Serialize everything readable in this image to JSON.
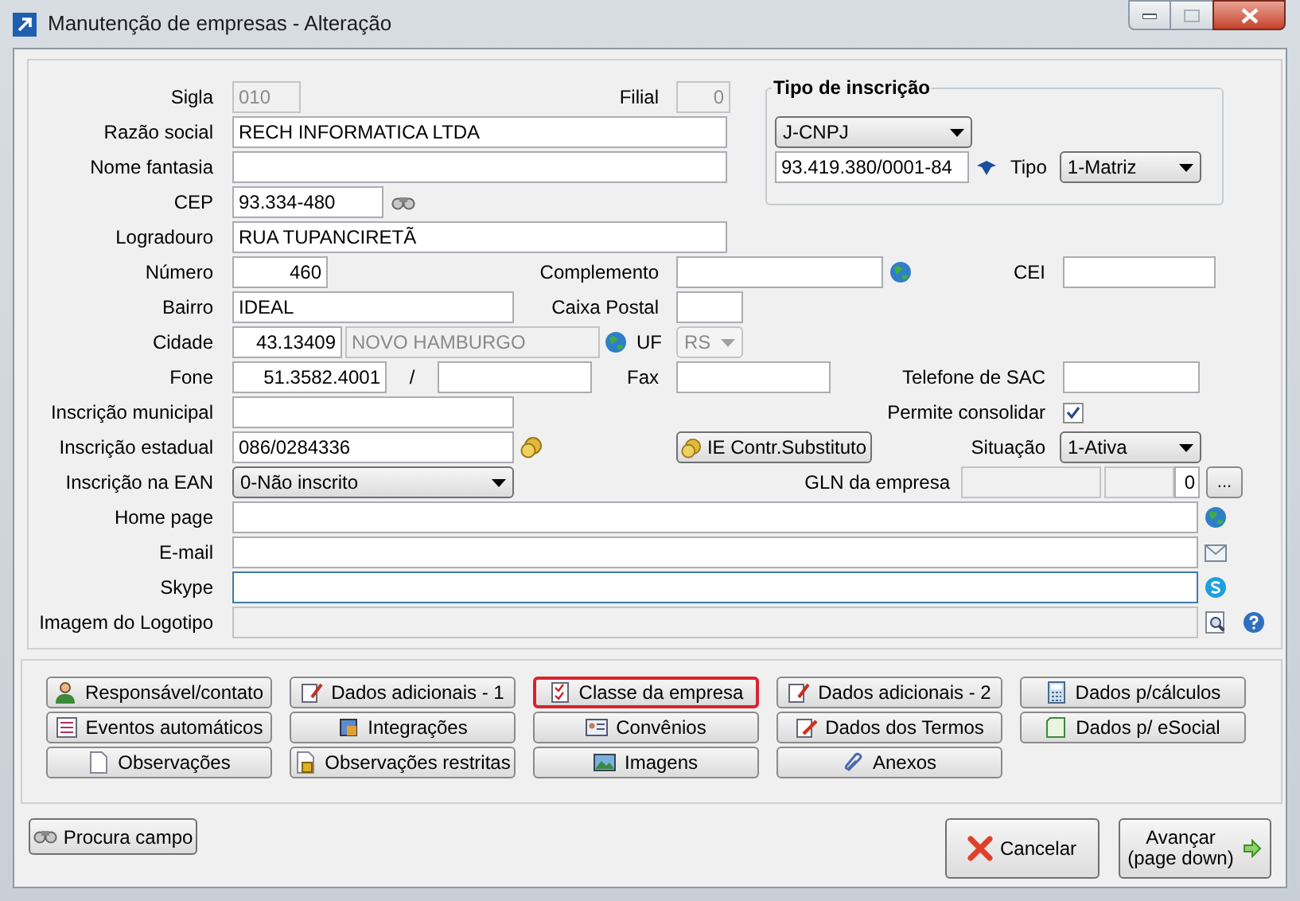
{
  "window": {
    "title": "Manutenção de empresas - Alteração"
  },
  "form": {
    "sigla": {
      "label": "Sigla",
      "value": "010",
      "disabled": true
    },
    "filial": {
      "label": "Filial",
      "value": "0",
      "disabled": true
    },
    "razao_social": {
      "label": "Razão social",
      "value": "RECH INFORMATICA LTDA",
      "disabled": false
    },
    "nome_fantasia": {
      "label": "Nome fantasia",
      "disabled": false
    },
    "cep": {
      "label": "CEP",
      "value": "93.334-480",
      "disabled": false
    },
    "logradouro": {
      "label": "Logradouro",
      "value": "RUA TUPANCIRETÃ",
      "disabled": false
    },
    "numero": {
      "label": "Número",
      "value": "460",
      "disabled": false
    },
    "complemento": {
      "label": "Complemento",
      "disabled": false
    },
    "cei": {
      "label": "CEI",
      "disabled": false
    },
    "bairro": {
      "label": "Bairro",
      "value": "IDEAL",
      "disabled": false
    },
    "caixa_postal": {
      "label": "Caixa Postal",
      "disabled": false
    },
    "cidade": {
      "label": "Cidade",
      "value": "43.13409",
      "disabled": false
    },
    "cidade_nome": {
      "value": "NOVO HAMBURGO",
      "disabled": true
    },
    "uf": {
      "label": "UF",
      "value": "RS",
      "disabled": true
    },
    "fone": {
      "label": "Fone",
      "value": "51.3582.4001",
      "disabled": false
    },
    "fone_separator": "/",
    "fone_2": {
      "disabled": false
    },
    "fax": {
      "label": "Fax",
      "disabled": false
    },
    "telefone_sac": {
      "label": "Telefone de SAC",
      "disabled": false
    },
    "inscricao_municipal": {
      "label": "Inscrição municipal",
      "disabled": false
    },
    "permite_consolidar": {
      "label": "Permite consolidar",
      "checked": true
    },
    "inscricao_estadual": {
      "label": "Inscrição estadual",
      "value": "086/0284336",
      "disabled": false
    },
    "ie_button": {
      "label": "IE Contr.Substituto"
    },
    "situacao": {
      "label": "Situação",
      "value": "1-Ativa",
      "disabled": false
    },
    "inscricao_ean": {
      "label": "Inscrição na EAN",
      "value": "0-Não inscrito",
      "disabled": false
    },
    "gln_label": "GLN da empresa",
    "gln_1": {
      "disabled": true
    },
    "gln_2": {
      "disabled": true
    },
    "gln_3": {
      "value": "0",
      "disabled": false
    },
    "gln_button": "...",
    "home_page": {
      "label": "Home page",
      "disabled": false
    },
    "email": {
      "label": "E-mail",
      "disabled": false
    },
    "skype": {
      "label": "Skype",
      "disabled": false,
      "focused": true
    },
    "imagem_logotipo": {
      "label": "Imagem do Logotipo",
      "disabled": true
    }
  },
  "tipo_inscricao": {
    "title": "Tipo de inscrição",
    "documento": {
      "value": "J-CNPJ",
      "disabled": false
    },
    "numero": {
      "value": "93.419.380/0001-84",
      "disabled": false
    },
    "tipo": {
      "label": "Tipo",
      "value": "1-Matriz",
      "disabled": false
    }
  },
  "buttons": [
    {
      "label": "Responsável/contato",
      "highlighted": false
    },
    {
      "label": "Dados adicionais - 1",
      "highlighted": false
    },
    {
      "label": "Classe da empresa",
      "highlighted": true
    },
    {
      "label": "Dados adicionais - 2",
      "highlighted": false
    },
    {
      "label": "Dados p/cálculos",
      "highlighted": false
    },
    {
      "label": "Eventos automáticos",
      "highlighted": false
    },
    {
      "label": "Integrações",
      "highlighted": false
    },
    {
      "label": "Convênios",
      "highlighted": false
    },
    {
      "label": "Dados dos Termos",
      "highlighted": false
    },
    {
      "label": "Dados p/ eSocial",
      "highlighted": false
    },
    {
      "label": "Observações",
      "highlighted": false
    },
    {
      "label": "Observações restritas",
      "highlighted": false
    },
    {
      "label": "Imagens",
      "highlighted": false
    },
    {
      "label": "Anexos",
      "highlighted": false
    }
  ],
  "footer": {
    "procura_campo": "Procura campo",
    "cancelar": "Cancelar",
    "avancar": "Avançar",
    "avancar_hint": "(page down)"
  }
}
